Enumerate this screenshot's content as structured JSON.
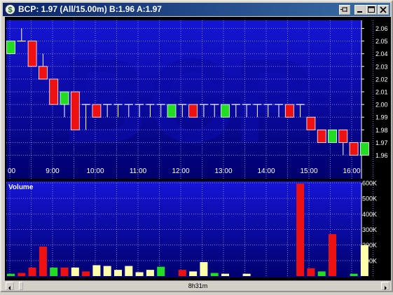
{
  "window": {
    "title": "BCP: 1.97 (All/15.00m)  B:1.96 A:1.97",
    "icon": "dollar-icon",
    "controls": [
      "pin-icon",
      "minimize-icon",
      "maximize-icon",
      "close-icon"
    ]
  },
  "watermark": "BCP",
  "colors": {
    "up": "#22dd22",
    "down": "#ee1111",
    "unchanged": "#ffffaa",
    "background_top": "#1010cc",
    "background_bottom": "#00007a",
    "grid": "#7f7fd9"
  },
  "scrollbar": {
    "label": "8h31m",
    "left_arrow": "scroll-left-icon",
    "right_arrow": "scroll-right-icon"
  },
  "chart_data": [
    {
      "type": "candlestick",
      "title": "",
      "x_ticks": [
        "00",
        "9:00",
        "10:00",
        "11:00",
        "12:00",
        "13:00",
        "14:00",
        "15:00",
        "16:00"
      ],
      "y_ticks": [
        "1.96",
        "1.97",
        "1.98",
        "1.99",
        "2.00",
        "2.01",
        "2.02",
        "2.03",
        "2.04",
        "2.05",
        "2.06"
      ],
      "ylim": [
        1.955,
        2.068
      ],
      "grid": true,
      "bars": [
        {
          "time": "8:00",
          "open": 2.04,
          "high": 2.05,
          "low": 2.04,
          "close": 2.05
        },
        {
          "time": "8:15",
          "open": 2.05,
          "high": 2.06,
          "low": 2.05,
          "close": 2.05
        },
        {
          "time": "8:30",
          "open": 2.05,
          "high": 2.05,
          "low": 2.03,
          "close": 2.03
        },
        {
          "time": "8:45",
          "open": 2.03,
          "high": 2.04,
          "low": 2.02,
          "close": 2.02
        },
        {
          "time": "9:00",
          "open": 2.02,
          "high": 2.02,
          "low": 2.0,
          "close": 2.0
        },
        {
          "time": "9:15",
          "open": 2.0,
          "high": 2.01,
          "low": 1.99,
          "close": 2.01
        },
        {
          "time": "9:30",
          "open": 2.01,
          "high": 2.01,
          "low": 1.98,
          "close": 1.98
        },
        {
          "time": "9:45",
          "open": 2.0,
          "high": 2.0,
          "low": 1.98,
          "close": 2.0
        },
        {
          "time": "10:00",
          "open": 2.0,
          "high": 2.0,
          "low": 1.99,
          "close": 1.99
        },
        {
          "time": "10:15",
          "open": 2.0,
          "high": 2.0,
          "low": 1.99,
          "close": 2.0
        },
        {
          "time": "10:30",
          "open": 2.0,
          "high": 2.0,
          "low": 1.99,
          "close": 2.0
        },
        {
          "time": "10:45",
          "open": 2.0,
          "high": 2.0,
          "low": 1.99,
          "close": 2.0
        },
        {
          "time": "11:00",
          "open": 2.0,
          "high": 2.0,
          "low": 1.99,
          "close": 2.0
        },
        {
          "time": "11:15",
          "open": 2.0,
          "high": 2.0,
          "low": 1.99,
          "close": 2.0
        },
        {
          "time": "11:30",
          "open": 2.0,
          "high": 2.0,
          "low": 1.99,
          "close": 2.0
        },
        {
          "time": "11:45",
          "open": 1.99,
          "high": 2.0,
          "low": 1.99,
          "close": 2.0
        },
        {
          "time": "12:00",
          "open": 2.0,
          "high": 2.0,
          "low": 1.99,
          "close": 2.0
        },
        {
          "time": "12:15",
          "open": 2.0,
          "high": 2.0,
          "low": 1.99,
          "close": 1.99
        },
        {
          "time": "12:30",
          "open": 2.0,
          "high": 2.0,
          "low": 1.99,
          "close": 2.0
        },
        {
          "time": "12:45",
          "open": 2.0,
          "high": 2.0,
          "low": 1.99,
          "close": 2.0
        },
        {
          "time": "13:00",
          "open": 1.99,
          "high": 2.0,
          "low": 1.99,
          "close": 2.0
        },
        {
          "time": "13:15",
          "open": 2.0,
          "high": 2.0,
          "low": 1.99,
          "close": 2.0
        },
        {
          "time": "13:30",
          "open": 2.0,
          "high": 2.0,
          "low": 1.99,
          "close": 2.0
        },
        {
          "time": "13:45",
          "open": 2.0,
          "high": 2.0,
          "low": 1.99,
          "close": 2.0
        },
        {
          "time": "14:00",
          "open": 2.0,
          "high": 2.0,
          "low": 1.99,
          "close": 2.0
        },
        {
          "time": "14:15",
          "open": 2.0,
          "high": 2.0,
          "low": 1.99,
          "close": 2.0
        },
        {
          "time": "14:30",
          "open": 2.0,
          "high": 2.0,
          "low": 1.99,
          "close": 1.99
        },
        {
          "time": "14:45",
          "open": 2.0,
          "high": 2.0,
          "low": 1.99,
          "close": 2.0
        },
        {
          "time": "15:00",
          "open": 1.99,
          "high": 1.99,
          "low": 1.98,
          "close": 1.98
        },
        {
          "time": "15:15",
          "open": 1.98,
          "high": 1.98,
          "low": 1.97,
          "close": 1.97
        },
        {
          "time": "15:30",
          "open": 1.97,
          "high": 1.98,
          "low": 1.97,
          "close": 1.98
        },
        {
          "time": "15:45",
          "open": 1.98,
          "high": 1.98,
          "low": 1.96,
          "close": 1.97
        },
        {
          "time": "16:00",
          "open": 1.97,
          "high": 1.97,
          "low": 1.96,
          "close": 1.96
        },
        {
          "time": "16:15",
          "open": 1.96,
          "high": 1.97,
          "low": 1.96,
          "close": 1.97
        }
      ]
    },
    {
      "type": "bar",
      "title": "Volume",
      "y_ticks": [
        "100K",
        "200K",
        "300K",
        "400K",
        "500K",
        "600K"
      ],
      "ylim": [
        0,
        600000
      ],
      "grid": true,
      "values": [
        15000,
        20000,
        55000,
        190000,
        55000,
        55000,
        55000,
        30000,
        70000,
        65000,
        40000,
        65000,
        25000,
        40000,
        60000,
        0,
        40000,
        30000,
        90000,
        20000,
        15000,
        0,
        15000,
        0,
        0,
        0,
        0,
        595000,
        50000,
        30000,
        270000,
        0,
        15000,
        200000
      ],
      "directions": [
        "up",
        "down",
        "down",
        "down",
        "up",
        "down",
        "unchanged",
        "down",
        "unchanged",
        "unchanged",
        "unchanged",
        "unchanged",
        "unchanged",
        "unchanged",
        "up",
        "none",
        "down",
        "unchanged",
        "unchanged",
        "up",
        "unchanged",
        "none",
        "unchanged",
        "none",
        "none",
        "none",
        "none",
        "down",
        "down",
        "up",
        "down",
        "none",
        "up",
        "unchanged"
      ]
    }
  ]
}
